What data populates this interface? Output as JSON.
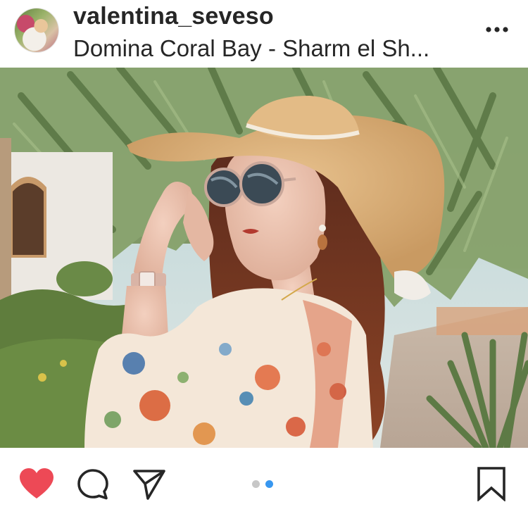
{
  "post": {
    "username": "valentina_seveso",
    "location": "Domina Coral Bay - Sharm el Sh...",
    "more_icon": "more-horizontal-icon"
  },
  "actions": {
    "like_icon": "heart-icon",
    "liked": true,
    "comment_icon": "comment-icon",
    "share_icon": "share-icon",
    "save_icon": "bookmark-icon"
  },
  "carousel": {
    "total": 2,
    "current": 2
  },
  "colors": {
    "heart": "#ed4956",
    "dot_active": "#3897f0",
    "dot_inactive": "#c7c7c7",
    "text": "#262626"
  }
}
